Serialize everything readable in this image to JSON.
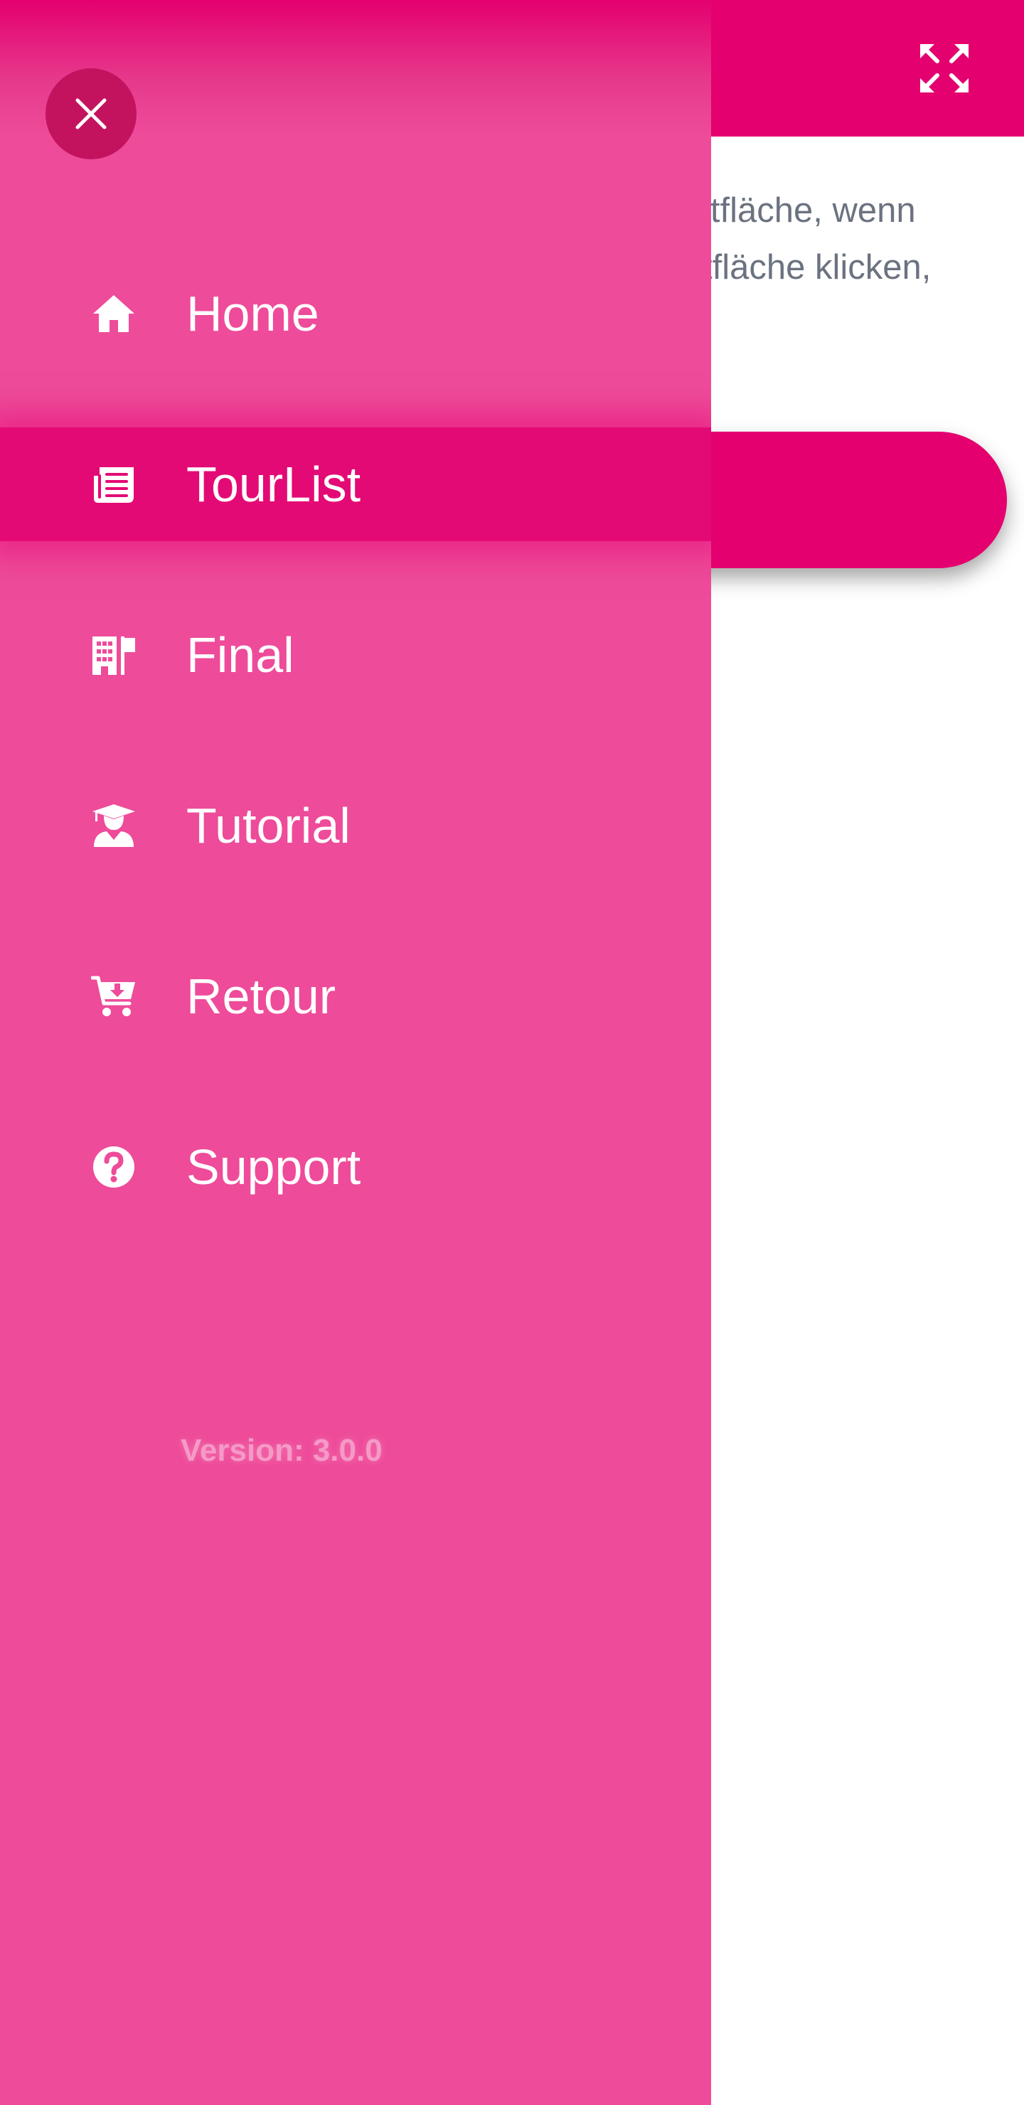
{
  "background": {
    "text_lines": [
      "ltfläche, wenn",
      "tfläche klicken,"
    ],
    "fullscreen_icon": "expand-arrows-icon"
  },
  "drawer": {
    "close_icon": "close-icon",
    "items": [
      {
        "label": "Home",
        "icon": "home-icon",
        "active": false
      },
      {
        "label": "TourList",
        "icon": "newspaper-icon",
        "active": true
      },
      {
        "label": "Final",
        "icon": "building-flag-icon",
        "active": false
      },
      {
        "label": "Tutorial",
        "icon": "graduate-icon",
        "active": false
      },
      {
        "label": "Retour",
        "icon": "cart-arrow-down-icon",
        "active": false
      },
      {
        "label": "Support",
        "icon": "question-circle-icon",
        "active": false
      }
    ],
    "version": "Version: 3.0.0"
  },
  "colors": {
    "brand": "#e4006f",
    "drawer": "#ee4b9a",
    "text_gray": "#6b7280",
    "version_text": "#f59ac6"
  }
}
